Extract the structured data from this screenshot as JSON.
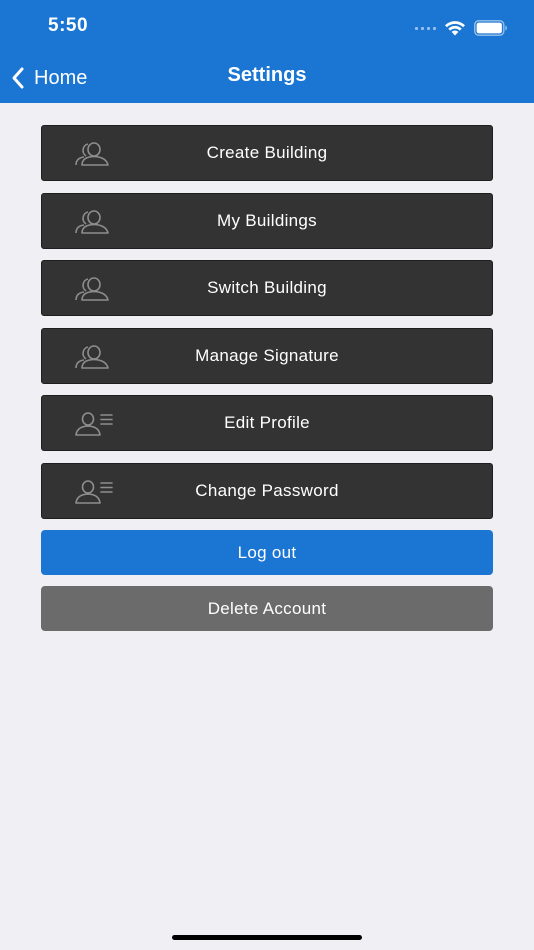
{
  "status_bar": {
    "time": "5:50"
  },
  "nav": {
    "back_label": "Home",
    "title": "Settings"
  },
  "menu_items": [
    {
      "label": "Create Building",
      "icon": "people-group-icon"
    },
    {
      "label": "My Buildings",
      "icon": "people-group-icon"
    },
    {
      "label": "Switch Building",
      "icon": "people-group-icon"
    },
    {
      "label": "Manage Signature",
      "icon": "people-group-icon"
    },
    {
      "label": "Edit Profile",
      "icon": "user-profile-icon"
    },
    {
      "label": "Change Password",
      "icon": "user-profile-icon"
    }
  ],
  "actions": {
    "logout_label": "Log out",
    "delete_label": "Delete Account"
  },
  "colors": {
    "header_bg": "#1a76d2",
    "menu_item_bg": "#333333",
    "logout_bg": "#1a76d2",
    "delete_bg": "#6b6b6b",
    "page_bg": "#efeff4"
  }
}
